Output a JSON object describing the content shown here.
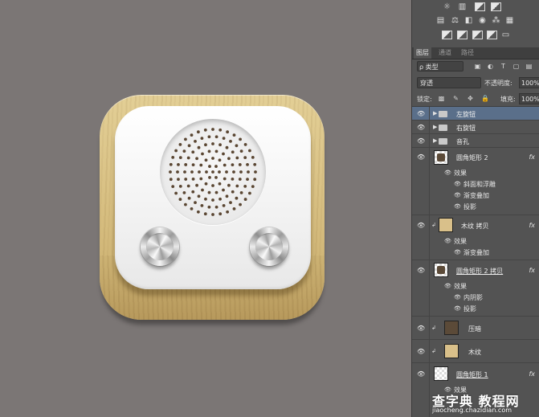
{
  "panel": {
    "tabs": [
      "图层",
      "通道",
      "路径"
    ],
    "filter_kind": "ρ 类型",
    "filter_icons": [
      "image-filter-icon",
      "adjustment-filter-icon",
      "type-filter-icon",
      "shape-filter-icon",
      "smart-object-filter-icon"
    ],
    "blend_mode": "穿透",
    "opacity_label": "不透明度:",
    "opacity_value": "100%",
    "lock_label": "锁定:",
    "fill_label": "填充:",
    "fill_value": "100%"
  },
  "layers": [
    {
      "name": "左旋钮",
      "type": "group"
    },
    {
      "name": "右旋钮",
      "type": "group"
    },
    {
      "name": "音孔",
      "type": "group"
    },
    {
      "name": "圆角矩形 2",
      "type": "shape",
      "fx": "fx",
      "effects_label": "效果",
      "effects": [
        "斜面和浮雕",
        "渐变叠加",
        "投影"
      ]
    },
    {
      "name": "木纹 拷贝",
      "type": "image",
      "fx": "fx",
      "effects_label": "效果",
      "effects": [
        "渐变叠加"
      ]
    },
    {
      "name": "圆角矩形 2 拷贝",
      "type": "shape",
      "fx": "fx",
      "effects_label": "效果",
      "effects": [
        "内阴影",
        "投影"
      ]
    },
    {
      "name": "压暗",
      "type": "fill"
    },
    {
      "name": "木纹",
      "type": "image"
    },
    {
      "name": "圆角矩形 1",
      "type": "shape",
      "fx": "fx",
      "effects_label": "效果"
    }
  ],
  "watermark": {
    "main": "查字典 教程网",
    "sub": "jiaocheng.chazidian.com"
  },
  "colors": {
    "canvas_bg": "#7b7675",
    "panel_bg": "#535353",
    "selected_row": "#5a6f8a",
    "wood": "#d6bd7f",
    "dark_fill": "#5b4a38"
  }
}
